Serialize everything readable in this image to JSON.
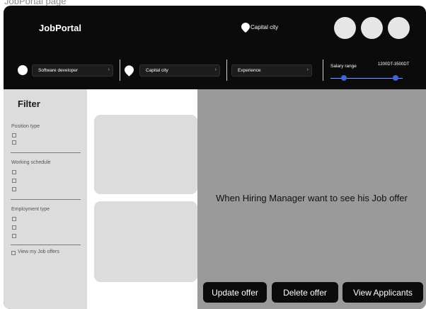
{
  "page": {
    "caption": "JobPortal page"
  },
  "header": {
    "logo": "JobPortal",
    "location": "Capital city"
  },
  "filters_bar": {
    "position": "Software developer",
    "city": "Capital city",
    "experience": "Experience",
    "salary_label": "Salary range",
    "salary_value": "1200DT-3500DT"
  },
  "sidebar": {
    "title": "Filter",
    "sections": [
      {
        "label": "Position type"
      },
      {
        "label": "Working schedule"
      },
      {
        "label": "Employment type"
      }
    ],
    "my_job_offers": "View my Job offers"
  },
  "detail": {
    "message": "When Hiring Manager want to see his Job offer"
  },
  "actions": {
    "update": "Update offer",
    "delete": "Delete offer",
    "view": "View Applicants"
  },
  "colors": {
    "frame": "#0b0b0b",
    "panel": "#dcdcdc",
    "detail": "#9a9a9a",
    "slider": "#3f63d8"
  }
}
